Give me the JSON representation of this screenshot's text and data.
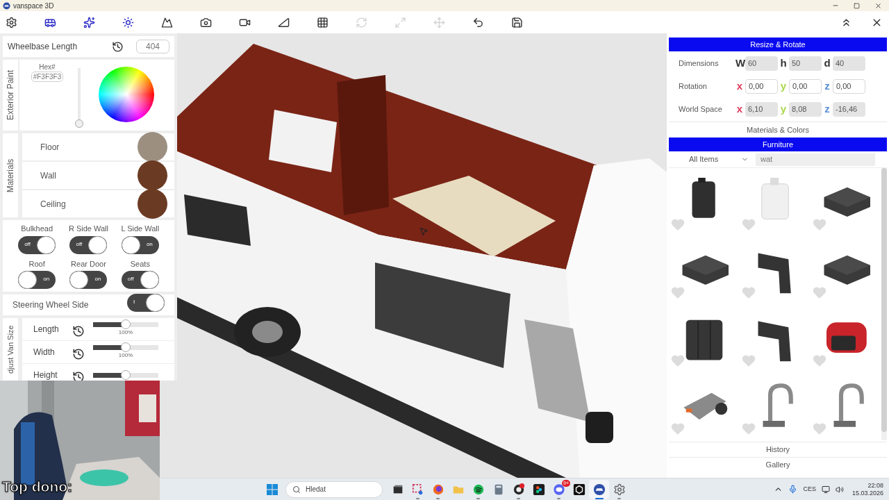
{
  "window": {
    "title": "vanspace 3D"
  },
  "toolbar": {
    "tools": [
      {
        "kind": "settings",
        "active": false,
        "disabled": false
      },
      {
        "kind": "van",
        "active": true,
        "disabled": false
      },
      {
        "kind": "effects",
        "active": true,
        "disabled": false
      },
      {
        "kind": "lighting",
        "active": true,
        "disabled": false
      },
      {
        "kind": "terrain",
        "active": false,
        "disabled": false
      },
      {
        "kind": "screenshot",
        "active": false,
        "disabled": false
      },
      {
        "kind": "video",
        "active": false,
        "disabled": false
      },
      {
        "kind": "measure",
        "active": false,
        "disabled": false
      },
      {
        "kind": "grid",
        "active": false,
        "disabled": false
      },
      {
        "kind": "rotate",
        "active": false,
        "disabled": true
      },
      {
        "kind": "scale",
        "active": false,
        "disabled": true
      },
      {
        "kind": "move",
        "active": false,
        "disabled": true
      },
      {
        "kind": "undo",
        "active": false,
        "disabled": false
      },
      {
        "kind": "save",
        "active": false,
        "disabled": false
      }
    ],
    "right_tools": [
      {
        "kind": "collapse"
      },
      {
        "kind": "close"
      }
    ]
  },
  "left_panel": {
    "wheelbase": {
      "label": "Wheelbase Length",
      "value": "404"
    },
    "exterior_paint": {
      "title": "Exterior Paint",
      "hex_label": "Hex#",
      "hex_value": "#F3F3F3",
      "brightness": {
        "level": 0
      }
    },
    "materials": {
      "title": "Materials",
      "items": [
        {
          "label": "Floor",
          "color": "#9c8f80"
        },
        {
          "label": "Wall",
          "color": "#6b3a22"
        },
        {
          "label": "Ceiling",
          "color": "#6b3a22"
        }
      ]
    },
    "toggles": [
      {
        "label": "Bulkhead",
        "on": true,
        "text": "off"
      },
      {
        "label": "R Side Wall",
        "on": true,
        "text": "off"
      },
      {
        "label": "L Side Wall",
        "on": false,
        "text": "on"
      },
      {
        "label": "Roof",
        "on": false,
        "text": "on"
      },
      {
        "label": "Rear Door",
        "on": false,
        "text": "on"
      },
      {
        "label": "Seats",
        "on": true,
        "text": "off"
      }
    ],
    "steering": {
      "label": "Steering Wheel Side",
      "on": true,
      "text": "I"
    },
    "van_size": {
      "title": "djust Van Size",
      "sliders": [
        {
          "label": "Length",
          "level": 0.5,
          "reading": "100%"
        },
        {
          "label": "Width",
          "level": 0.5,
          "reading": "100%"
        },
        {
          "label": "Height",
          "level": 0.5
        }
      ]
    }
  },
  "right_panel": {
    "resize": {
      "title": "Resize & Rotate",
      "rows": [
        {
          "label": "Dimensions",
          "editable": false,
          "fields": [
            {
              "axis": "W",
              "color": "#333333",
              "value": "60"
            },
            {
              "axis": "h",
              "color": "#333333",
              "value": "50"
            },
            {
              "axis": "d",
              "color": "#333333",
              "value": "40"
            }
          ]
        },
        {
          "label": "Rotation",
          "editable": true,
          "fields": [
            {
              "axis": "x",
              "color": "#e0395a",
              "value": "0,00"
            },
            {
              "axis": "y",
              "color": "#a8d84a",
              "value": "0,00"
            },
            {
              "axis": "z",
              "color": "#5b8fd6",
              "value": "0,00"
            }
          ]
        },
        {
          "label": "World Space",
          "editable": false,
          "fields": [
            {
              "axis": "x",
              "color": "#e0395a",
              "value": "6,10"
            },
            {
              "axis": "y",
              "color": "#a8d84a",
              "value": "8,08"
            },
            {
              "axis": "z",
              "color": "#5b8fd6",
              "value": "-16,46"
            }
          ]
        }
      ]
    },
    "materials_colors": {
      "title": "Materials & Colors"
    },
    "furniture": {
      "title": "Furniture",
      "filter": "All Items",
      "search": "wat",
      "items": [
        {
          "favorite": false
        },
        {
          "favorite": false
        },
        {
          "favorite": false
        },
        {
          "favorite": false
        },
        {
          "favorite": false
        },
        {
          "favorite": false
        },
        {
          "favorite": false
        },
        {
          "favorite": false
        },
        {
          "favorite": false
        },
        {
          "favorite": false
        },
        {
          "favorite": false
        },
        {
          "favorite": false
        }
      ]
    },
    "history": {
      "title": "History"
    },
    "gallery": {
      "title": "Gallery"
    }
  },
  "webcam": {
    "caption": "Top dono:"
  },
  "taskbar": {
    "search_placeholder": "Hledat",
    "apps": [
      {
        "kind": "taskview",
        "running": false,
        "selected": false
      },
      {
        "kind": "snip",
        "running": true,
        "selected": false
      },
      {
        "kind": "browser",
        "running": true,
        "selected": false
      },
      {
        "kind": "files",
        "running": false,
        "selected": false
      },
      {
        "kind": "music",
        "running": true,
        "selected": false
      },
      {
        "kind": "calculator",
        "running": false,
        "selected": false
      },
      {
        "kind": "recorder",
        "running": true,
        "selected": false
      },
      {
        "kind": "design",
        "running": false,
        "selected": false
      },
      {
        "kind": "chat",
        "running": true,
        "selected": false,
        "badge": "9+"
      },
      {
        "kind": "engine",
        "running": false,
        "selected": false
      },
      {
        "kind": "vanspace",
        "running": true,
        "selected": true
      },
      {
        "kind": "settings",
        "running": true,
        "selected": false
      }
    ],
    "tray": {
      "language": "CES",
      "time": "22:08",
      "date": "15.03.2026"
    }
  }
}
